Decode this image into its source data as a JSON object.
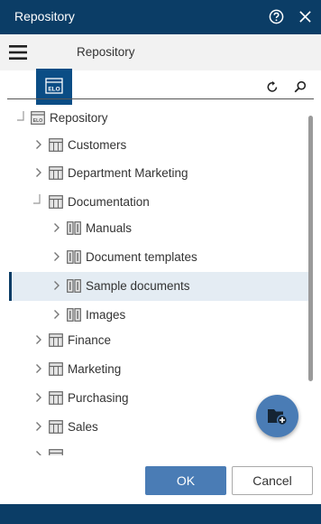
{
  "window": {
    "title": "Repository"
  },
  "header": {
    "title": "Repository",
    "logo_text": "ELO"
  },
  "tree": {
    "root": {
      "label": "Repository"
    },
    "items": [
      {
        "label": "Customers"
      },
      {
        "label": "Department Marketing"
      },
      {
        "label": "Documentation"
      },
      {
        "label": "Manuals"
      },
      {
        "label": "Document templates"
      },
      {
        "label": "Sample documents"
      },
      {
        "label": "Images"
      },
      {
        "label": "Finance"
      },
      {
        "label": "Marketing"
      },
      {
        "label": "Purchasing"
      },
      {
        "label": "Sales"
      }
    ],
    "selected": "Sample documents"
  },
  "buttons": {
    "ok": "OK",
    "cancel": "Cancel"
  },
  "colors": {
    "titlebar": "#0b3d66",
    "accent": "#4a7cb5",
    "selection": "#e4ecf3"
  },
  "icons": [
    "help-icon",
    "close-icon",
    "menu-icon",
    "elo-logo-icon",
    "refresh-icon",
    "search-icon",
    "cabinet-icon",
    "binder-icon",
    "new-folder-icon"
  ]
}
